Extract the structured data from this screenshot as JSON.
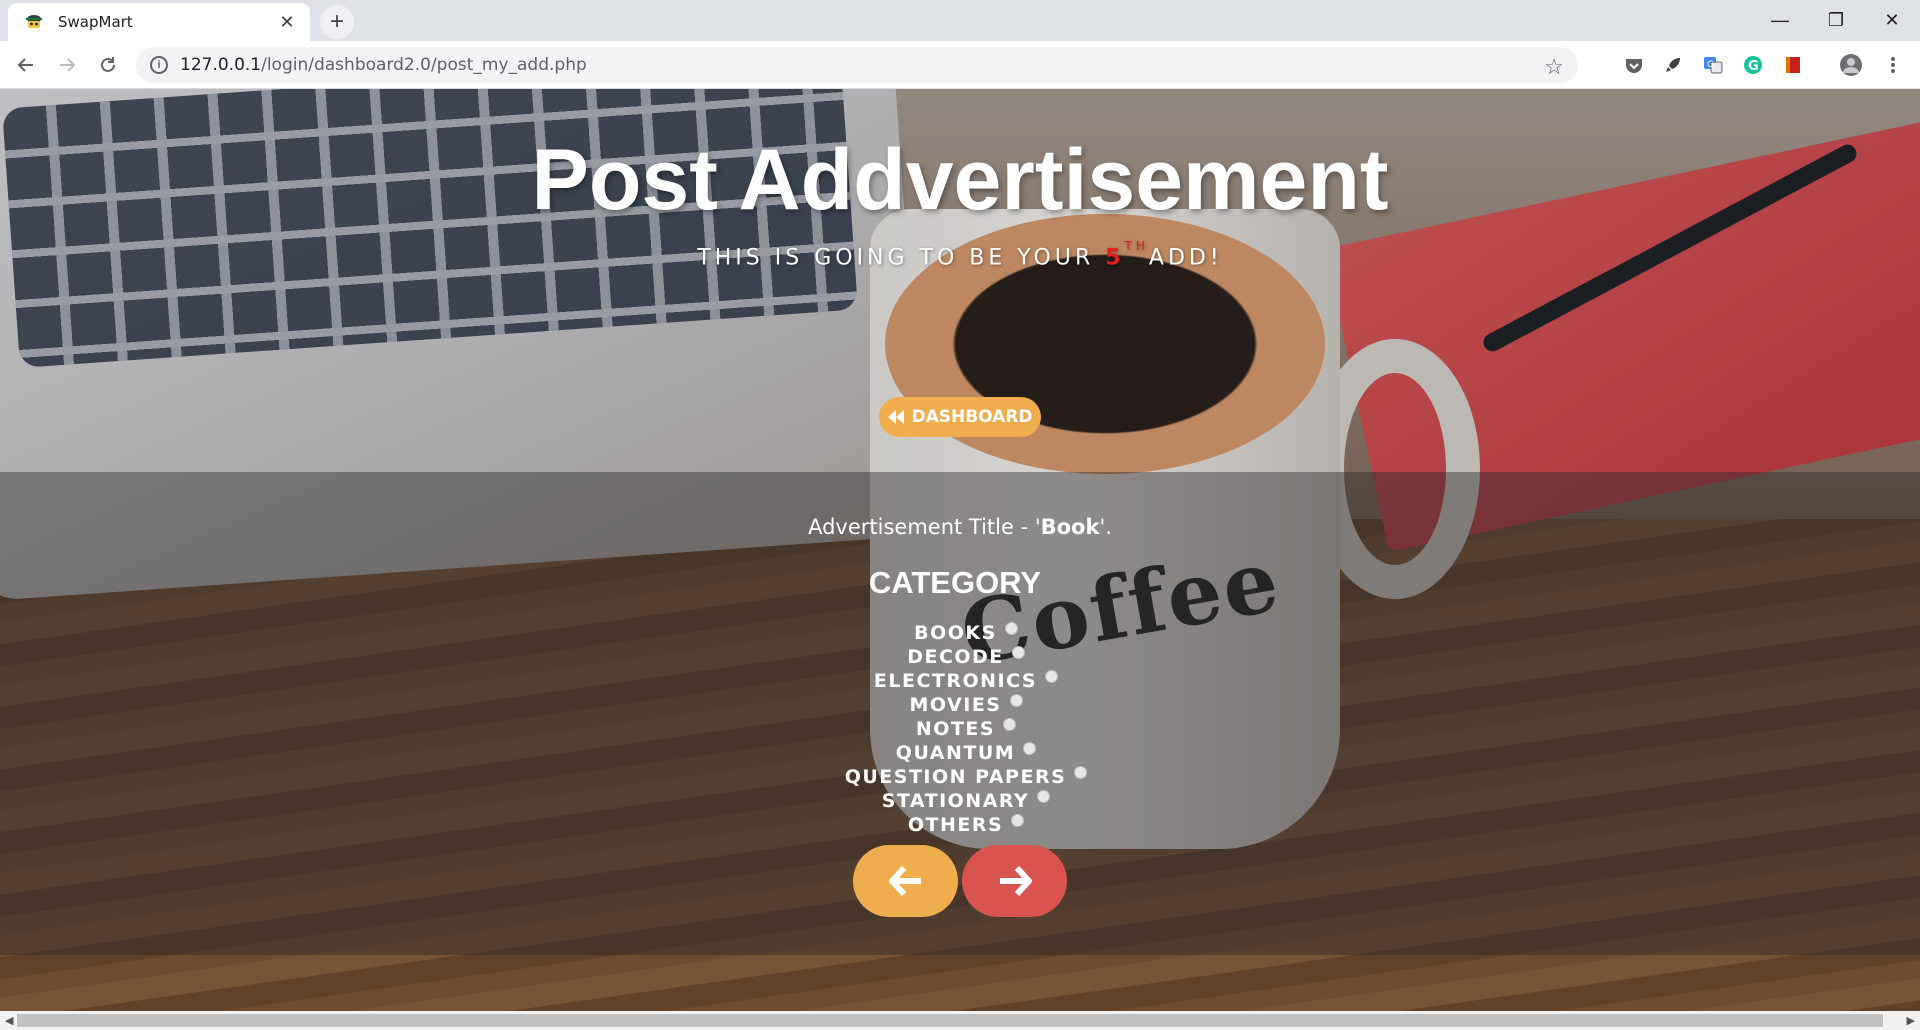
{
  "browser": {
    "tab_title": "SwapMart",
    "url_host": "127.0.0.1",
    "url_path": "/login/dashboard2.0/post_my_add.php"
  },
  "hero": {
    "title": "Post Addvertisement",
    "subtitle_pre": "This is going to be your ",
    "subtitle_num": "5",
    "subtitle_sup": "th",
    "subtitle_post": "add!",
    "dashboard_label": "DASHBOARD"
  },
  "form": {
    "ad_title_prefix": "Advertisement Title - '",
    "ad_title_value": "Book",
    "ad_title_suffix": "'.",
    "category_heading": "CATEGORY",
    "categories": [
      "BOOKS",
      "DECODE",
      "ELECTRONICS",
      "MOVIES",
      "NOTES",
      "QUANTUM",
      "QUESTION PAPERS",
      "STATIONARY",
      "OTHERS"
    ]
  },
  "colors": {
    "accent_orange": "#f0ad4e",
    "accent_red": "#d9534f",
    "highlight_red": "#e4201d"
  },
  "icons": {
    "prev": "arrow-left-icon",
    "next": "arrow-right-icon",
    "dashboard": "backward-icon"
  }
}
